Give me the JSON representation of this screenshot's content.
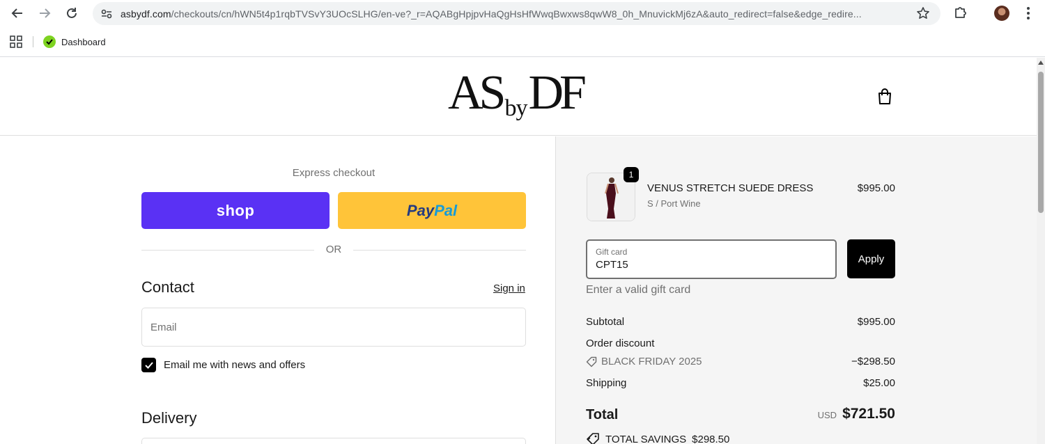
{
  "browser": {
    "url_host": "asbydf.com",
    "url_path": "/checkouts/cn/hWN5t4p1rqbTVSvY3UOcSLHG/en-ve?_r=AQABgHpjpvHaQgHsHfWwqBwxws8qwW8_0h_MnuvickMj6zA&auto_redirect=false&edge_redire...",
    "bookmark_label": "Dashboard"
  },
  "header": {
    "logo_part1": "AS",
    "logo_part2": "by",
    "logo_part3": "DF"
  },
  "checkout": {
    "express_label": "Express checkout",
    "shop_label": "shop",
    "paypal_pay": "Pay",
    "paypal_pal": "Pal",
    "or_label": "OR",
    "contact_heading": "Contact",
    "signin_label": "Sign in",
    "email_placeholder": "Email",
    "email_opt_in_label": "Email me with news and offers",
    "email_opt_in_checked": true,
    "delivery_heading": "Delivery"
  },
  "summary": {
    "product": {
      "name": "VENUS STRETCH SUEDE DRESS",
      "variant": "S / Port Wine",
      "price": "$995.00",
      "quantity": "1"
    },
    "gift_card": {
      "label": "Gift card",
      "value": "CPT15",
      "apply_label": "Apply",
      "error": "Enter a valid gift card"
    },
    "subtotal_label": "Subtotal",
    "subtotal_value": "$995.00",
    "order_discount_label": "Order discount",
    "discount_code": "BLACK FRIDAY 2025",
    "discount_value": "−$298.50",
    "shipping_label": "Shipping",
    "shipping_value": "$25.00",
    "total_label": "Total",
    "total_currency": "USD",
    "total_value": "$721.50",
    "savings_label": "TOTAL SAVINGS",
    "savings_value": "$298.50"
  },
  "colors": {
    "shop_purple": "#5a31f4",
    "paypal_yellow": "#ffc439",
    "summary_bg": "#f5f5f5"
  }
}
